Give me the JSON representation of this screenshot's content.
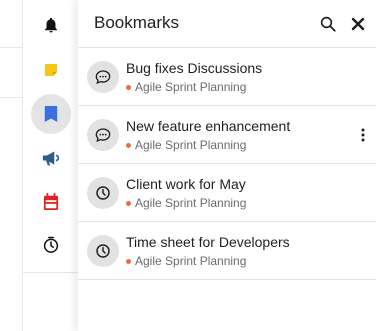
{
  "panel": {
    "title": "Bookmarks",
    "search_icon": "search-icon",
    "close_icon": "close-icon"
  },
  "rail": {
    "items": [
      {
        "name": "notifications",
        "icon": "bell-icon",
        "color": "#111111",
        "active": false
      },
      {
        "name": "notes",
        "icon": "sticky-note-icon",
        "color": "#f5c518",
        "active": false
      },
      {
        "name": "bookmarks",
        "icon": "bookmark-icon",
        "color": "#3b6fe0",
        "active": true
      },
      {
        "name": "announcements",
        "icon": "megaphone-icon",
        "color": "#2f5d86",
        "active": false
      },
      {
        "name": "calendar",
        "icon": "calendar-icon",
        "color": "#e02424",
        "active": false
      },
      {
        "name": "time-tracker",
        "icon": "clock-check-icon",
        "color": "#111111",
        "active": false
      }
    ]
  },
  "bookmarks": [
    {
      "title": "Bug fixes Discussions",
      "project": "Agile Sprint Planning",
      "icon": "chat-icon"
    },
    {
      "title": "New feature enhancement",
      "project": "Agile Sprint Planning",
      "icon": "chat-icon",
      "has_more": true
    },
    {
      "title": "Client work for May",
      "project": "Agile Sprint Planning",
      "icon": "clock-icon"
    },
    {
      "title": "Time sheet for Developers",
      "project": "Agile Sprint Planning",
      "icon": "clock-icon"
    }
  ],
  "colors": {
    "project_dot": "#f26b3a",
    "active_rail_bg": "#e4e4e4"
  }
}
